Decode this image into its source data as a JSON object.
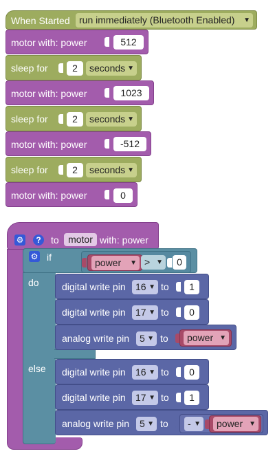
{
  "stack1": {
    "hat": {
      "label": "When Started",
      "mode": "run immediately (Bluetooth Enabled)"
    },
    "blocks": [
      {
        "kind": "motor",
        "label": "motor  with:  power",
        "value": "512"
      },
      {
        "kind": "sleep",
        "label": "sleep for",
        "value": "2",
        "unit": "seconds"
      },
      {
        "kind": "motor",
        "label": "motor  with:  power",
        "value": "1023"
      },
      {
        "kind": "sleep",
        "label": "sleep for",
        "value": "2",
        "unit": "seconds"
      },
      {
        "kind": "motor",
        "label": "motor  with:  power",
        "value": "-512"
      },
      {
        "kind": "sleep",
        "label": "sleep for",
        "value": "2",
        "unit": "seconds"
      },
      {
        "kind": "motor",
        "label": "motor  with:  power",
        "value": "0"
      }
    ]
  },
  "procedure": {
    "to_label": "to",
    "name": "motor",
    "params_label": "with: power",
    "if_block": {
      "if_label": "if",
      "do_label": "do",
      "else_label": "else",
      "condition": {
        "left": "power",
        "operator": ">",
        "right": "0"
      },
      "do": [
        {
          "label": "digital write pin",
          "pin": "16",
          "to": "to",
          "value": "1"
        },
        {
          "label": "digital write pin",
          "pin": "17",
          "to": "to",
          "value": "0"
        },
        {
          "label": "analog write pin",
          "pin": "5",
          "to": "to",
          "variable": "power"
        }
      ],
      "else": [
        {
          "label": "digital write pin",
          "pin": "16",
          "to": "to",
          "value": "0"
        },
        {
          "label": "digital write pin",
          "pin": "17",
          "to": "to",
          "value": "1"
        },
        {
          "label": "analog write pin",
          "pin": "5",
          "to": "to",
          "negate": "-",
          "variable": "power"
        }
      ]
    }
  },
  "colors": {
    "control": "#9dac5f",
    "motor": "#a35cac",
    "pins": "#5b67a6",
    "logic": "#5b8fa3",
    "variable": "#a84a68"
  }
}
